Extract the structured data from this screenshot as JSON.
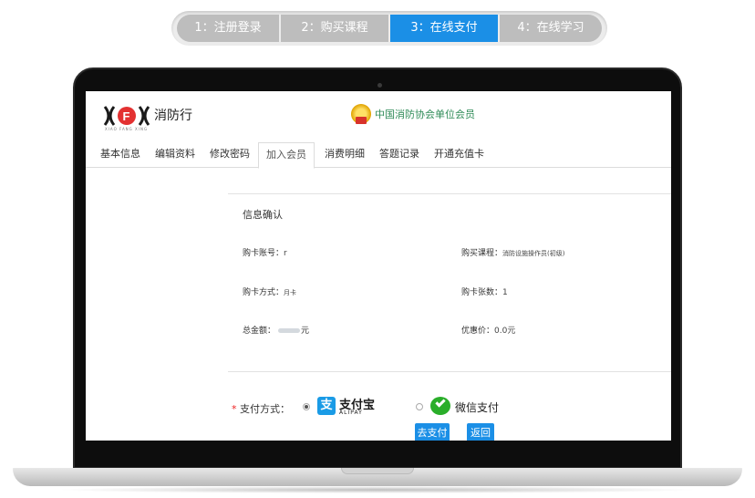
{
  "steps": [
    {
      "label": "1：注册登录"
    },
    {
      "label": "2：购买课程"
    },
    {
      "label": "3：在线支付"
    },
    {
      "label": "4：在线学习"
    }
  ],
  "active_step": 3,
  "site": {
    "logo_text": "消防行",
    "logo_sub": "XIAO FANG XING",
    "member_text": "中国消防协会单位会员"
  },
  "tabs": [
    {
      "label": "基本信息"
    },
    {
      "label": "编辑资料"
    },
    {
      "label": "修改密码"
    },
    {
      "label": "加入会员"
    },
    {
      "label": "消费明细"
    },
    {
      "label": "答题记录"
    },
    {
      "label": "开通充值卡"
    }
  ],
  "active_tab": "加入会员",
  "info": {
    "title": "信息确认",
    "card_account_label": "购卡账号：",
    "card_account_value": "r",
    "course_label": "购买课程：",
    "course_value": "消防设施操作员(初级)",
    "method_label": "购卡方式：",
    "method_value": "月卡",
    "count_label": "购卡张数：",
    "count_value": "1",
    "total_label": "总金额：",
    "total_unit": "元",
    "discount_label": "优惠价：",
    "discount_value": "0.0元"
  },
  "payment": {
    "required_mark": "*",
    "label": "支付方式：",
    "options": [
      {
        "name": "支付宝",
        "sub": "ALIPAY",
        "selected": true
      },
      {
        "name": "微信支付",
        "selected": false
      }
    ]
  },
  "buttons": {
    "pay": "去支付",
    "back": "返回"
  },
  "colors": {
    "accent": "#1b8fe6",
    "step_inactive": "#bdbdbd",
    "member_green": "#2e8b57",
    "wechat_green": "#2aae2a"
  }
}
